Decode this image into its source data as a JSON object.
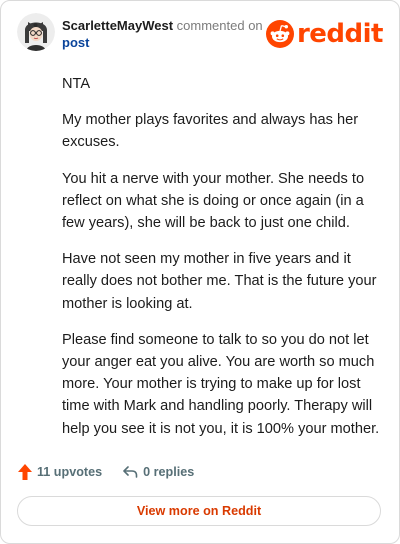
{
  "header": {
    "username": "ScarletteMayWest",
    "action_text": "commented on",
    "post_link": "post",
    "brand": "reddit"
  },
  "comment": {
    "paragraphs": [
      "NTA",
      "My mother plays favorites and always has her excuses.",
      "You hit a nerve with your mother. She needs to reflect on what she is doing or once again (in a few years), she will be back to just one child.",
      "Have not seen my mother in five years and it really does not bother me. That is the future your mother is looking at.",
      "Please find someone to talk to so you do not let your anger eat you alive. You are worth so much more. Your mother is trying to make up for lost time with Mark and handling poorly. Therapy will help you see it is not you, it is 100% your mother."
    ]
  },
  "actions": {
    "upvotes": "11 upvotes",
    "replies": "0 replies"
  },
  "footer": {
    "view_more": "View more on Reddit"
  },
  "icons": {
    "avatar": "avatar-icon",
    "reddit_logo": "reddit-logo-icon",
    "upvote": "upvote-arrow-icon",
    "reply": "reply-arrow-icon"
  },
  "colors": {
    "brand_orange": "#ff4500",
    "link_blue": "#0a449b",
    "muted_text": "#576f76",
    "view_more_text": "#d93a00",
    "border": "#dadada"
  }
}
